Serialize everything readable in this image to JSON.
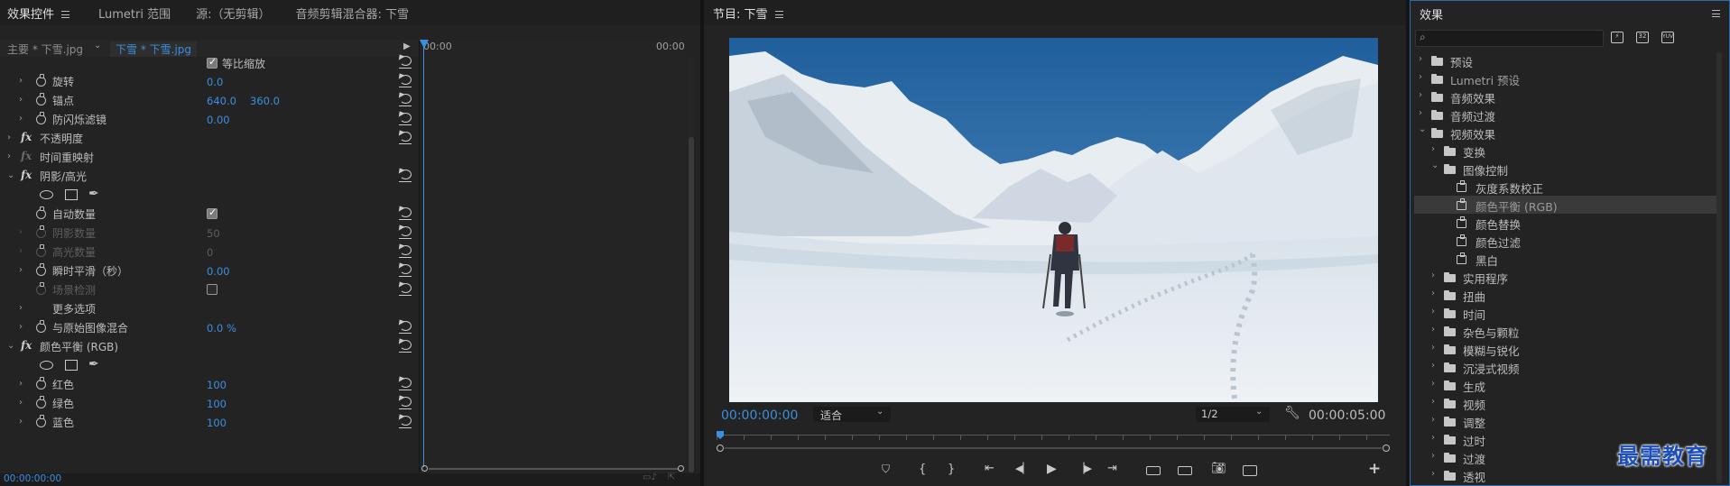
{
  "effect_controls": {
    "tabs": [
      "效果控件",
      "Lumetri 范围",
      "源:（无剪辑）",
      "音频剪辑混合器: 下雪"
    ],
    "master_label": "主要 * 下雪.jpg",
    "clip_label": "下雪 * 下雪.jpg",
    "time_start": "00:00",
    "time_end": "00:00",
    "footer_time": "00:00:00:00",
    "rows": {
      "uniform_scale": "等比缩放",
      "rotation": "旋转",
      "rotation_val": "0.0",
      "anchor": "锚点",
      "anchor_x": "640.0",
      "anchor_y": "360.0",
      "anti_flicker": "防闪烁滤镜",
      "anti_flicker_val": "0.00",
      "opacity": "不透明度",
      "time_remap": "时间重映射",
      "shadow_highlight": "阴影/高光",
      "auto_amount": "自动数量",
      "shadow_amount": "阴影数量",
      "shadow_amount_val": "50",
      "highlight_amount": "高光数量",
      "highlight_amount_val": "0",
      "temporal_smooth": "瞬时平滑（秒）",
      "temporal_smooth_val": "0.00",
      "scene_detect": "场景检测",
      "more_options": "更多选项",
      "blend_original": "与原始图像混合",
      "blend_original_val": "0.0 %",
      "color_balance": "颜色平衡 (RGB)",
      "red": "红色",
      "red_val": "100",
      "green": "绿色",
      "green_val": "100",
      "blue": "蓝色",
      "blue_val": "100"
    }
  },
  "program": {
    "title": "节目: 下雪",
    "timecode": "00:00:00:00",
    "fit": "适合",
    "resolution": "1/2",
    "duration": "00:00:05:00"
  },
  "effects": {
    "title": "效果",
    "search_placeholder": "",
    "items": [
      {
        "label": "预设",
        "level": 0,
        "type": "preset",
        "open": false
      },
      {
        "label": "Lumetri 预设",
        "level": 0,
        "type": "preset",
        "open": false
      },
      {
        "label": "音频效果",
        "level": 0,
        "type": "folder",
        "open": false
      },
      {
        "label": "音频过渡",
        "level": 0,
        "type": "folder",
        "open": false
      },
      {
        "label": "视频效果",
        "level": 0,
        "type": "folder",
        "open": true
      },
      {
        "label": "变换",
        "level": 1,
        "type": "folder",
        "open": false
      },
      {
        "label": "图像控制",
        "level": 1,
        "type": "folder",
        "open": true
      },
      {
        "label": "灰度系数校正",
        "level": 2,
        "type": "effect"
      },
      {
        "label": "颜色平衡 (RGB)",
        "level": 2,
        "type": "effect",
        "selected": true
      },
      {
        "label": "颜色替换",
        "level": 2,
        "type": "effect"
      },
      {
        "label": "颜色过滤",
        "level": 2,
        "type": "effect"
      },
      {
        "label": "黑白",
        "level": 2,
        "type": "effect"
      },
      {
        "label": "实用程序",
        "level": 1,
        "type": "folder",
        "open": false
      },
      {
        "label": "扭曲",
        "level": 1,
        "type": "folder",
        "open": false
      },
      {
        "label": "时间",
        "level": 1,
        "type": "folder",
        "open": false
      },
      {
        "label": "杂色与颗粒",
        "level": 1,
        "type": "folder",
        "open": false
      },
      {
        "label": "模糊与锐化",
        "level": 1,
        "type": "folder",
        "open": false
      },
      {
        "label": "沉浸式视频",
        "level": 1,
        "type": "folder",
        "open": false
      },
      {
        "label": "生成",
        "level": 1,
        "type": "folder",
        "open": false
      },
      {
        "label": "视频",
        "level": 1,
        "type": "folder",
        "open": false
      },
      {
        "label": "调整",
        "level": 1,
        "type": "folder",
        "open": false
      },
      {
        "label": "过时",
        "level": 1,
        "type": "folder",
        "open": false
      },
      {
        "label": "过渡",
        "level": 1,
        "type": "folder",
        "open": false
      },
      {
        "label": "透视",
        "level": 1,
        "type": "folder",
        "open": false
      }
    ]
  },
  "watermark": "最需教育"
}
